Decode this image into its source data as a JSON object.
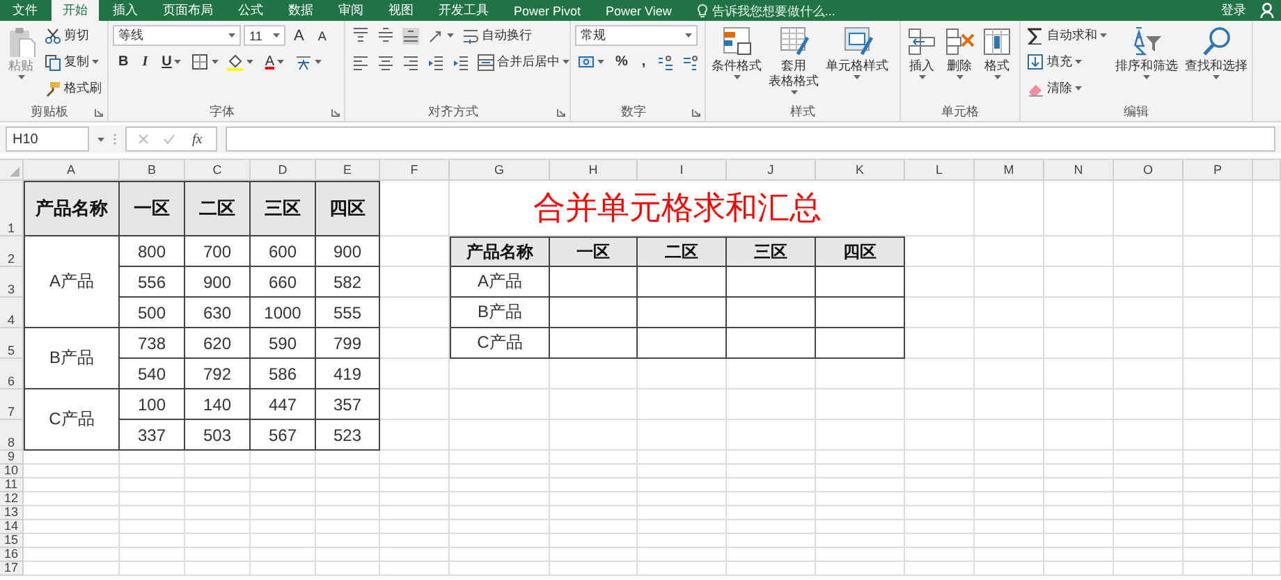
{
  "tabs": [
    {
      "label": "文件",
      "selected": false
    },
    {
      "label": "开始",
      "selected": true
    },
    {
      "label": "插入",
      "selected": false
    },
    {
      "label": "页面布局",
      "selected": false
    },
    {
      "label": "公式",
      "selected": false
    },
    {
      "label": "数据",
      "selected": false
    },
    {
      "label": "审阅",
      "selected": false
    },
    {
      "label": "视图",
      "selected": false
    },
    {
      "label": "开发工具",
      "selected": false
    },
    {
      "label": "Power Pivot",
      "selected": false
    },
    {
      "label": "Power View",
      "selected": false
    }
  ],
  "tell_me": {
    "placeholder": "告诉我您想要做什么..."
  },
  "sign_in": "登录",
  "ribbon": {
    "groups": [
      {
        "kind": "clipboard",
        "label": "剪贴板",
        "launcher": true,
        "paste": "粘贴",
        "items": [
          "剪切",
          "复制",
          "格式刷"
        ]
      },
      {
        "kind": "font",
        "label": "字体",
        "launcher": true,
        "font": "等线",
        "size": "11",
        "grow": "A",
        "shrink": "A",
        "bold": "B",
        "italic": "I",
        "underline": "U",
        "font_color": "A"
      },
      {
        "kind": "alignment",
        "label": "对齐方式",
        "launcher": true,
        "wrap": "自动换行",
        "merge": "合并后居中"
      },
      {
        "kind": "number",
        "label": "数字",
        "launcher": true,
        "format": "常规",
        "percent": "%",
        "comma": ","
      },
      {
        "kind": "styles",
        "label": "样式",
        "launcher": false,
        "items": [
          [
            "条件格式"
          ],
          [
            "套用",
            "表格格式"
          ],
          [
            "单元格样式"
          ]
        ]
      },
      {
        "kind": "cells",
        "label": "单元格",
        "launcher": false,
        "items": [
          "插入",
          "删除",
          "格式"
        ]
      },
      {
        "kind": "editing",
        "label": "编辑",
        "launcher": false,
        "small": [
          "自动求和",
          "填充",
          "清除"
        ],
        "large": [
          "排序和筛选",
          "查找和选择"
        ]
      }
    ]
  },
  "formula_bar": {
    "name_box": "H10",
    "function_label": "fx"
  },
  "sheet": {
    "columns": [
      "A",
      "B",
      "C",
      "D",
      "E",
      "F",
      "G",
      "H",
      "I",
      "J",
      "K",
      "L",
      "M",
      "N",
      "O",
      "P"
    ],
    "rows": [
      "1",
      "2",
      "3",
      "4",
      "5",
      "6",
      "7",
      "8",
      "9",
      "10",
      "11",
      "12",
      "13",
      "14",
      "15",
      "16",
      "17"
    ]
  },
  "left_table": {
    "columns": [
      "产品名称",
      "一区",
      "二区",
      "三区",
      "四区"
    ],
    "groups": [
      {
        "product": "A产品",
        "rows": [
          [
            "800",
            "700",
            "600",
            "900"
          ],
          [
            "556",
            "900",
            "660",
            "582"
          ],
          [
            "500",
            "630",
            "1000",
            "555"
          ]
        ]
      },
      {
        "product": "B产品",
        "rows": [
          [
            "738",
            "620",
            "590",
            "799"
          ],
          [
            "540",
            "792",
            "586",
            "419"
          ]
        ]
      },
      {
        "product": "C产品",
        "rows": [
          [
            "100",
            "140",
            "447",
            "357"
          ],
          [
            "337",
            "503",
            "567",
            "523"
          ]
        ]
      }
    ]
  },
  "right_table": {
    "title": "合并单元格求和汇总",
    "columns": [
      "产品名称",
      "一区",
      "二区",
      "三区",
      "四区"
    ],
    "rows": [
      "A产品",
      "B产品",
      "C产品"
    ]
  }
}
